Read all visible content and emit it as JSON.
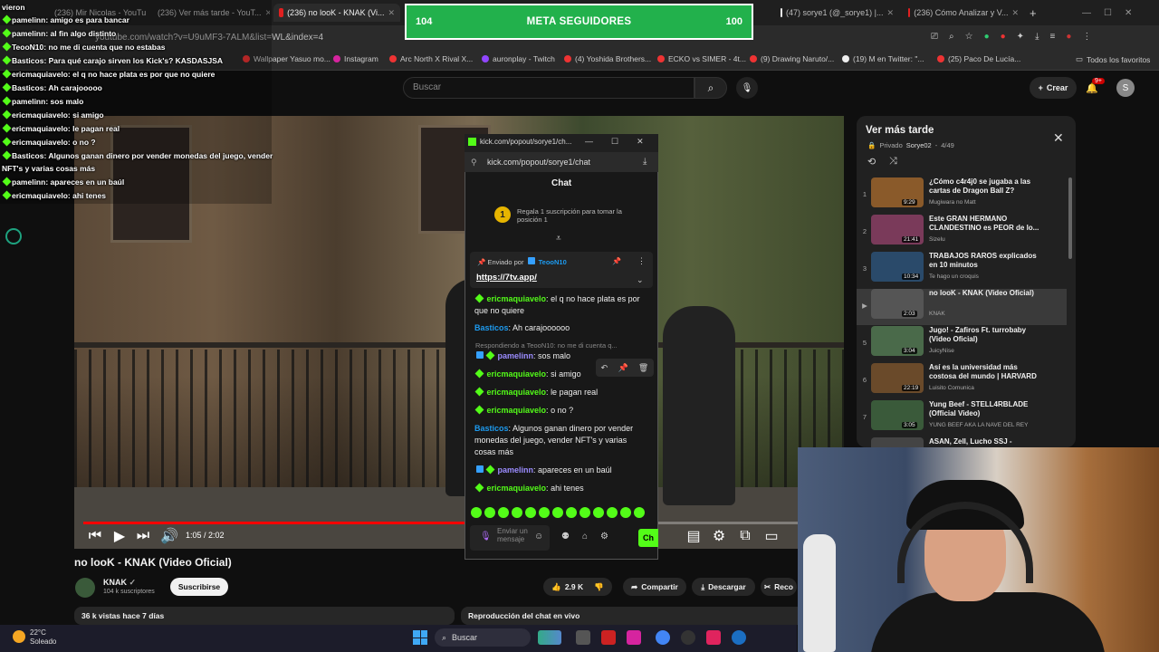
{
  "browser": {
    "tabs": [
      {
        "label": "(236) Mir Nicolas - YouTube"
      },
      {
        "label": "(236) Ver más tarde - YouT..."
      },
      {
        "label": "(236) no looK - KNAK (Vi..."
      },
      {
        "label": "(47) sorye1 (@_sorye1) |..."
      },
      {
        "label": "(236) Cómo Analizar y V..."
      }
    ],
    "url": "youtube.com/watch?v=U9uMF3-7ALM&list=WL&index=4",
    "bookmarks": [
      "Wallpaper Yasuo mo...",
      "Instagram",
      "Arc North X Rival X...",
      "auronplay - Twitch",
      "(4) Yoshida Brothers...",
      "ECKO vs SIMER - 4t...",
      "(9) Drawing Naruto/...",
      "(19) M en Twitter: \"...",
      "(25) Paco De Lucía...",
      "Todos los favoritos"
    ]
  },
  "header": {
    "search_placeholder": "Buscar",
    "create_label": "Crear",
    "notifications": "9+",
    "avatar_letter": "S"
  },
  "meta": {
    "left": "104",
    "label": "META SEGUIDORES",
    "right": "100"
  },
  "overlay_chat": [
    {
      "user": "vieron",
      "text": ""
    },
    {
      "user": "pamelinn",
      "text": "amigo es para bancar"
    },
    {
      "user": "pamelinn",
      "text": "al fin algo distinto"
    },
    {
      "user": "TeooN10",
      "text": "no me di cuenta que no estabas"
    },
    {
      "user": "Basticos",
      "text": "Para qué carajo sirven los Kick's? KASDASJSA"
    },
    {
      "user": "ericmaquiavelo",
      "text": "el q no hace plata es por que no quiere"
    },
    {
      "user": "Basticos",
      "text": "Ah carajooooo"
    },
    {
      "user": "pamelinn",
      "text": "sos malo"
    },
    {
      "user": "ericmaquiavelo",
      "text": "si amigo"
    },
    {
      "user": "ericmaquiavelo",
      "text": "le pagan real"
    },
    {
      "user": "ericmaquiavelo",
      "text": "o no ?"
    },
    {
      "user": "Basticos",
      "text": "Algunos ganan dinero por vender monedas del juego, vender"
    },
    {
      "user": "",
      "text": "NFT's y varias cosas más"
    },
    {
      "user": "pamelinn",
      "text": "apareces en un baúl"
    },
    {
      "user": "ericmaquiavelo",
      "text": "ahi tenes"
    }
  ],
  "video": {
    "time": "1:05 / 2:02",
    "progress_fraction": 0.53,
    "title": "no looK - KNAK (Video Oficial)",
    "channel": "KNAK",
    "subscribers": "104 k suscriptores",
    "subscribe_label": "Suscribirse",
    "likes": "2.9 K",
    "share_label": "Compartir",
    "download_label": "Descargar",
    "clip_label": "Reco",
    "views": "36 k vistas  hace 7 días",
    "chat_replay": "Reproducción del chat en vivo"
  },
  "kick": {
    "window_title": "kick.com/popout/sorye1/ch...",
    "url": "kick.com/popout/sorye1/chat",
    "chat_title": "Chat",
    "gift_text": "Regala 1 suscripción para tomar la posición 1",
    "pinned_prefix": "Enviado por",
    "pinned_user": "TeooN10",
    "pinned_link": "https://7tv.app/",
    "reply_text": "Respondiendo a TeooN10: no me di cuenta q...",
    "messages": [
      {
        "user": "ericmaquiavelo",
        "text": "el q no hace plata es por que no quiere",
        "color": "g"
      },
      {
        "user": "Basticos",
        "text": "Ah carajoooooo",
        "color": "b"
      },
      {
        "user": "pamelinn",
        "text": "sos malo",
        "color": "p"
      },
      {
        "user": "ericmaquiavelo",
        "text": "si amigo",
        "color": "g"
      },
      {
        "user": "ericmaquiavelo",
        "text": "le pagan real",
        "color": "g"
      },
      {
        "user": "ericmaquiavelo",
        "text": "o no ?",
        "color": "g"
      },
      {
        "user": "Basticos",
        "text": "Algunos ganan dinero por vender monedas del juego, vender NFT's y varias cosas más",
        "color": "b"
      },
      {
        "user": "pamelinn",
        "text": "apareces en un baúl",
        "color": "p"
      },
      {
        "user": "ericmaquiavelo",
        "text": "ahi tenes",
        "color": "g"
      }
    ],
    "input_placeholder": "Enviar un mensaje",
    "send_label": "Ch"
  },
  "playlist": {
    "title": "Ver más tarde",
    "privacy": "Privado",
    "owner": "Sorye02",
    "position": "4/49",
    "items": [
      {
        "idx": "1",
        "title": "¿Cómo c4r4j0 se jugaba a las cartas de Dragon Ball Z?",
        "channel": "Mugiwara no Matt",
        "duration": "9:29"
      },
      {
        "idx": "2",
        "title": "Este GRAN HERMANO CLANDESTINO es PEOR de lo...",
        "channel": "Sizelu",
        "duration": "21:41"
      },
      {
        "idx": "3",
        "title": "TRABAJOS RAROS explicados en 10 minutos",
        "channel": "Te hago un croquis",
        "duration": "10:34"
      },
      {
        "idx": "▶",
        "title": "no looK - KNAK (Video Oficial)",
        "channel": "KNAK",
        "duration": "2:03"
      },
      {
        "idx": "5",
        "title": "Jugo! - Zafiros Ft. turrobaby (Video Oficial)",
        "channel": "JuicyNise",
        "duration": "3:04"
      },
      {
        "idx": "6",
        "title": "Así es la universidad más costosa del mundo | HARVARD",
        "channel": "Luisito Comunica",
        "duration": "22:19"
      },
      {
        "idx": "7",
        "title": "Yung Beef - STELL4RBLADE (Official Video)",
        "channel": "YUNG BEEF AKA LA NAVE DEL REY",
        "duration": "3:05"
      },
      {
        "idx": "",
        "title": "ASAN, Zell, Lucho SSJ -",
        "channel": "",
        "duration": ""
      }
    ]
  },
  "taskbar": {
    "temp": "22°C",
    "weather": "Soleado",
    "search": "Buscar"
  }
}
